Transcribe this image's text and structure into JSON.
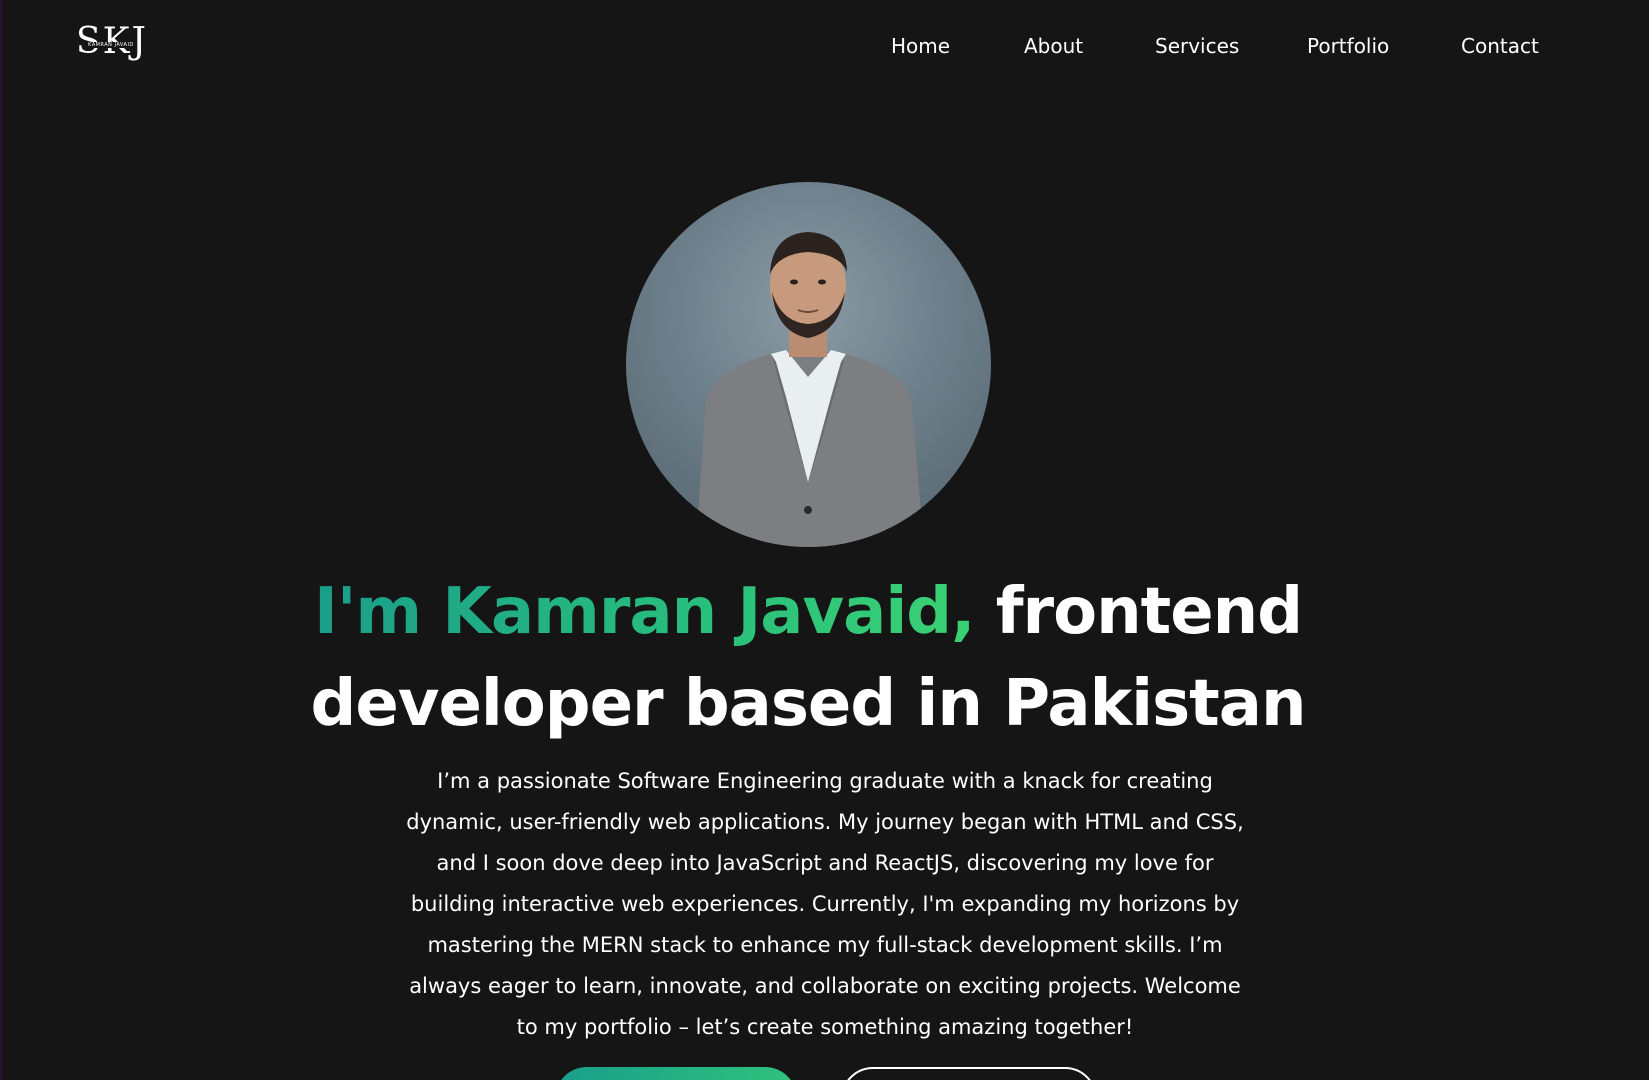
{
  "header": {
    "logo": {
      "mark": "SKJ",
      "subtext": "KAMRAN JAVAID"
    },
    "nav": [
      {
        "label": "Home"
      },
      {
        "label": "About"
      },
      {
        "label": "Services"
      },
      {
        "label": "Portfolio"
      },
      {
        "label": "Contact"
      }
    ]
  },
  "hero": {
    "avatar_icon": "profile-photo",
    "headline_highlight": "I'm Kamran Javaid,",
    "headline_rest_1": "frontend",
    "headline_line_2": "developer based in Pakistan",
    "bio": "I’m a passionate Software Engineering graduate with a knack for creating dynamic, user-friendly web applications. My journey began with HTML and CSS, and I soon dove deep into JavaScript and ReactJS, discovering my love for building interactive web experiences. Currently, I'm expanding my horizons by mastering the MERN stack to enhance my full-stack development skills. I’m always eager to learn, innovate, and collaborate on exciting projects. Welcome to my portfolio – let’s create something amazing together!"
  },
  "colors": {
    "background": "#161515",
    "accent_start": "#1a9e8a",
    "accent_end": "#3ad174",
    "text": "#ffffff"
  }
}
